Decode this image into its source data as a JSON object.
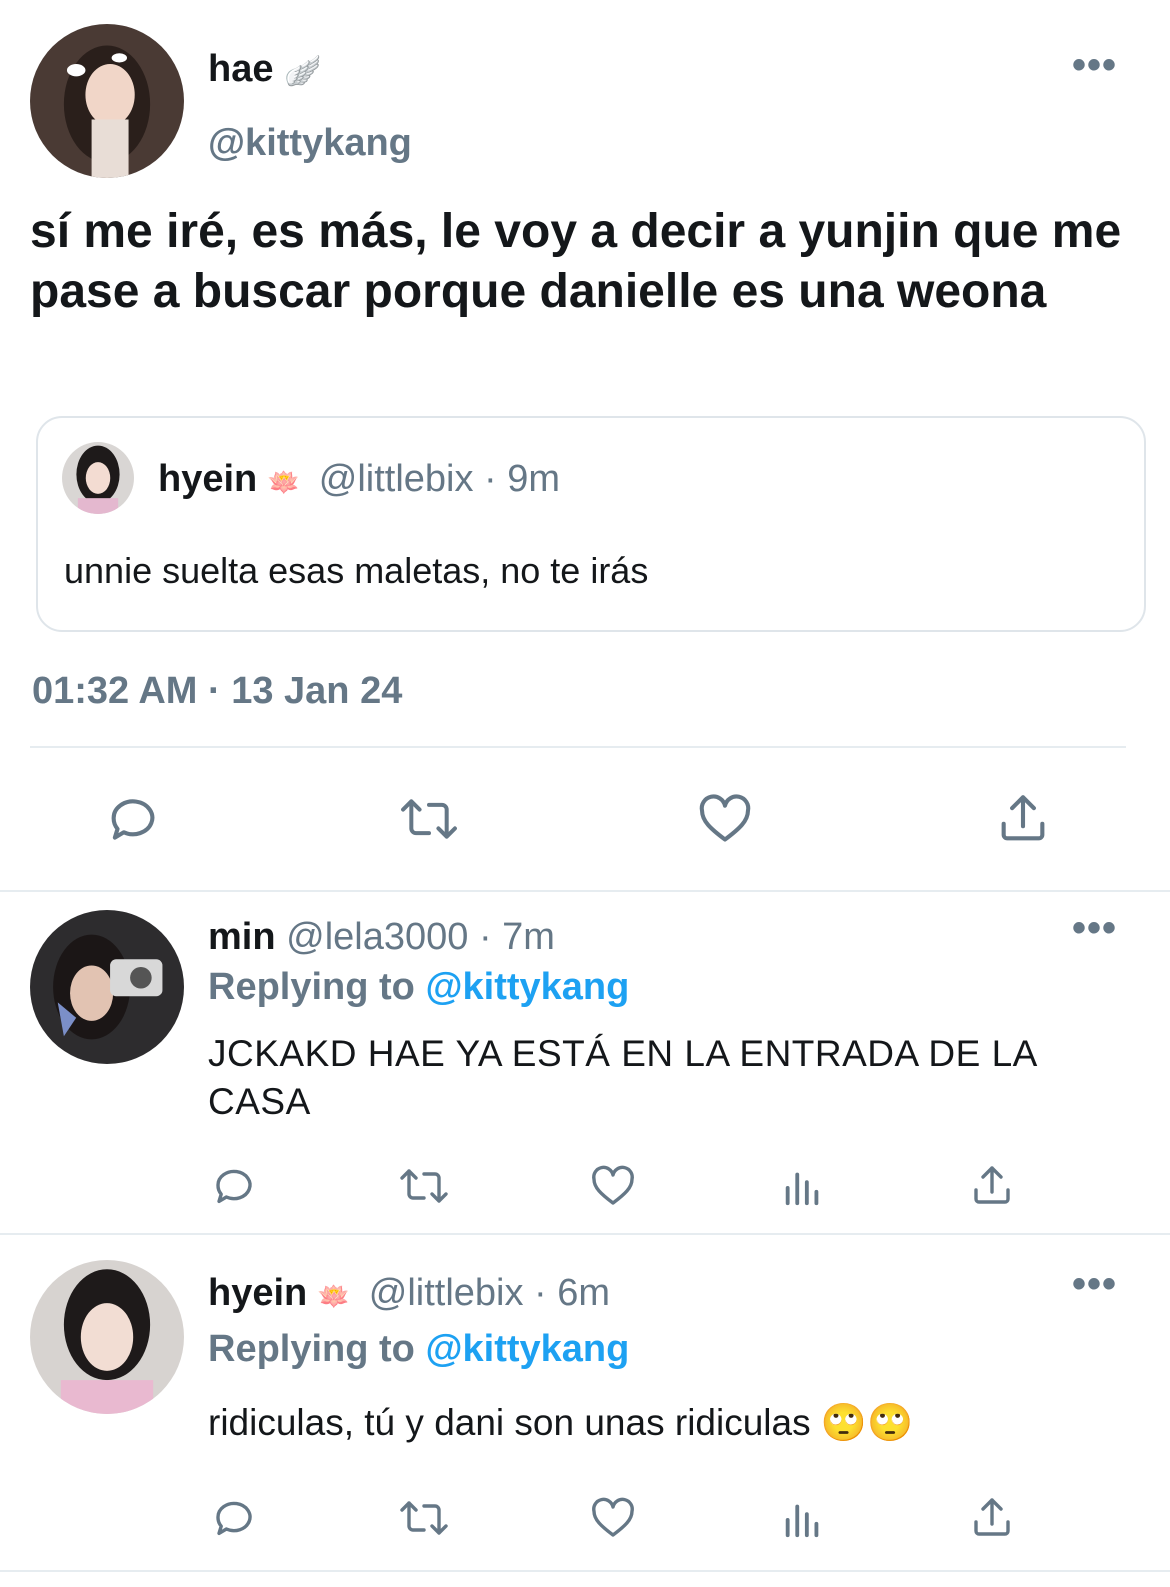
{
  "main_tweet": {
    "display_name": "hae",
    "name_emoji": "🪽",
    "handle": "@kittykang",
    "text": "sí me iré, es más, le voy a decir a yunjin que me pase a buscar porque danielle es una weona",
    "quoted": {
      "display_name": "hyein",
      "name_emoji": "🪷",
      "handle": "@littlebix",
      "time": "· 9m",
      "text": "unnie suelta esas maletas, no te irás"
    },
    "timestamp": "01:32 AM · 13 Jan 24",
    "actions": [
      "reply-icon",
      "retweet-icon",
      "like-icon",
      "share-icon"
    ]
  },
  "replies": [
    {
      "display_name": "min",
      "handle": "@lela3000",
      "time": "· 7m",
      "replying_label": "Replying to",
      "replying_to": "@kittykang",
      "text": "JCKAKD HAE YA ESTÁ EN LA ENTRADA DE LA CASA",
      "actions": [
        "reply-icon",
        "retweet-icon",
        "like-icon",
        "analytics-icon",
        "share-icon"
      ]
    },
    {
      "display_name": "hyein",
      "name_emoji": "🪷",
      "handle": "@littlebix",
      "time": "· 6m",
      "replying_label": "Replying to",
      "replying_to": "@kittykang",
      "text": "ridiculas, tú y dani son unas ridiculas",
      "emojis": "🙄🙄",
      "actions": [
        "reply-icon",
        "retweet-icon",
        "like-icon",
        "analytics-icon",
        "share-icon"
      ]
    }
  ],
  "colors": {
    "text": "#14171a",
    "secondary": "#657786",
    "link": "#1da1f2",
    "divider": "#e6ecf0"
  }
}
